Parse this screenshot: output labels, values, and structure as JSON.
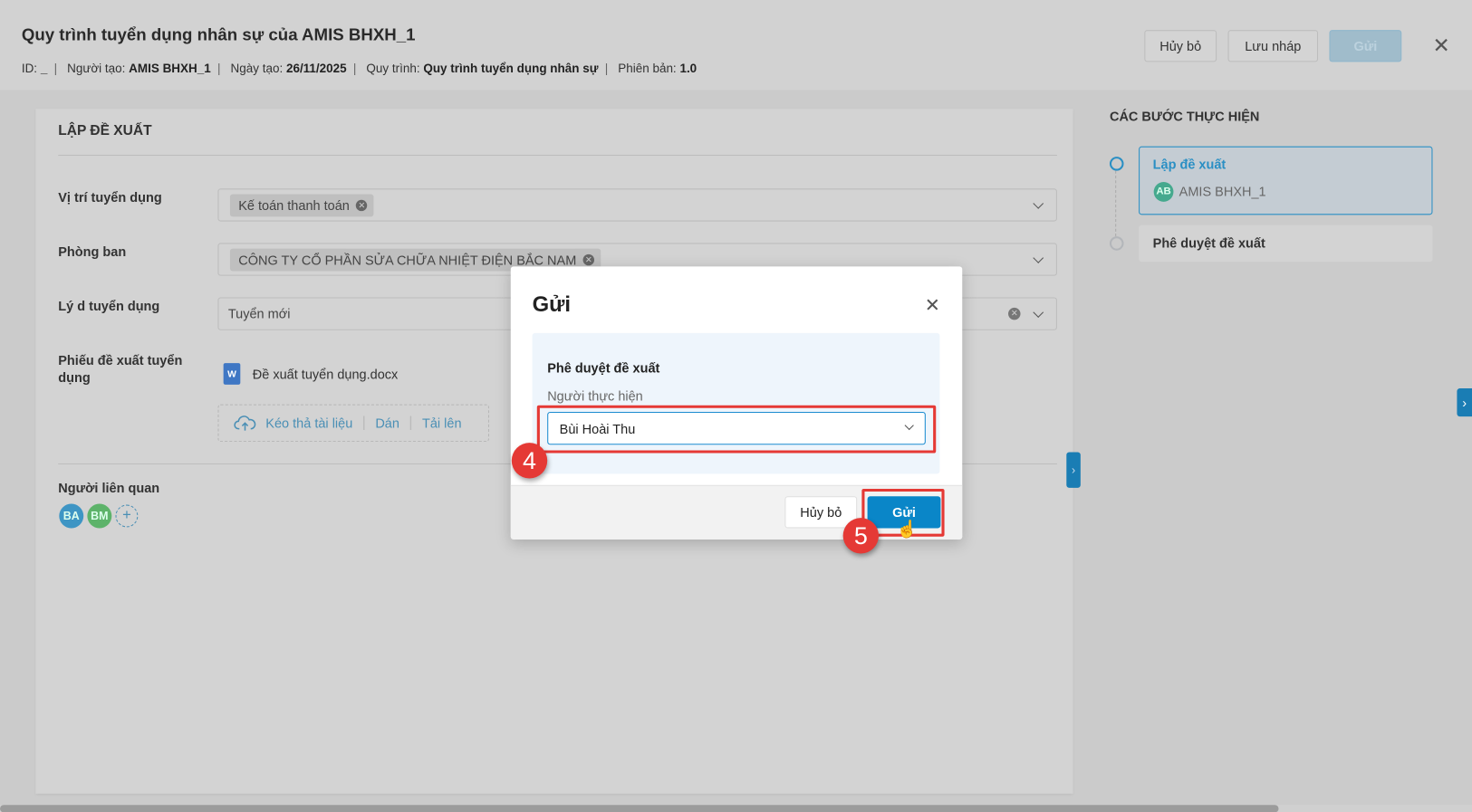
{
  "header": {
    "title": "Quy trình tuyển dụng nhân sự của AMIS BHXH_1",
    "meta": [
      {
        "label": "ID:",
        "value": "_"
      },
      {
        "label": "Người tạo:",
        "value": "AMIS BHXH_1"
      },
      {
        "label": "Ngày tạo:",
        "value": "26/11/2025"
      },
      {
        "label": "Quy trình:",
        "value": "Quy trình tuyển dụng nhân sự"
      },
      {
        "label": "Phiên bản:",
        "value": "1.0"
      }
    ],
    "cancel_label": "Hủy bỏ",
    "draft_label": "Lưu nháp",
    "send_label": "Gửi"
  },
  "form": {
    "section_title": "LẬP ĐỀ XUẤT",
    "position": {
      "label": "Vị trí tuyển dụng",
      "value": "Kế toán thanh toán"
    },
    "department": {
      "label": "Phòng ban",
      "value": "CÔNG TY CỔ PHẦN SỬA CHỮA NHIỆT ĐIỆN BẮC NAM"
    },
    "reason": {
      "label": "Lý d tuyển dụng",
      "value": "Tuyển mới"
    },
    "attachment": {
      "label": "Phiếu đề xuất tuyển dụng",
      "file": "Đề xuất tuyển dụng.docx",
      "file_icon_text": "W",
      "drag": "Kéo thả tài liệu",
      "paste": "Dán",
      "upload": "Tải lên"
    },
    "related": {
      "label": "Người liên quan",
      "avatars": [
        {
          "initials": "BA",
          "color": "#3e95c4"
        },
        {
          "initials": "BM",
          "color": "#5db36a"
        }
      ],
      "add": "+"
    }
  },
  "steps": {
    "title": "CÁC BƯỚC THỰC HIỆN",
    "items": [
      {
        "name": "Lập đề xuất",
        "user_initials": "AB",
        "user": "AMIS BHXH_1"
      },
      {
        "name": "Phê duyệt đề xuất"
      }
    ]
  },
  "modal": {
    "title": "Gửi",
    "step_name": "Phê duyệt đề xuất",
    "assignee_label": "Người thực hiện",
    "assignee_value": "Bùi Hoài Thu",
    "cancel_label": "Hủy bỏ",
    "send_label": "Gửi"
  },
  "annotations": {
    "step4": "4",
    "step5": "5"
  },
  "colors": {
    "accent": "#0a86c8",
    "annotation": "#e53935"
  }
}
